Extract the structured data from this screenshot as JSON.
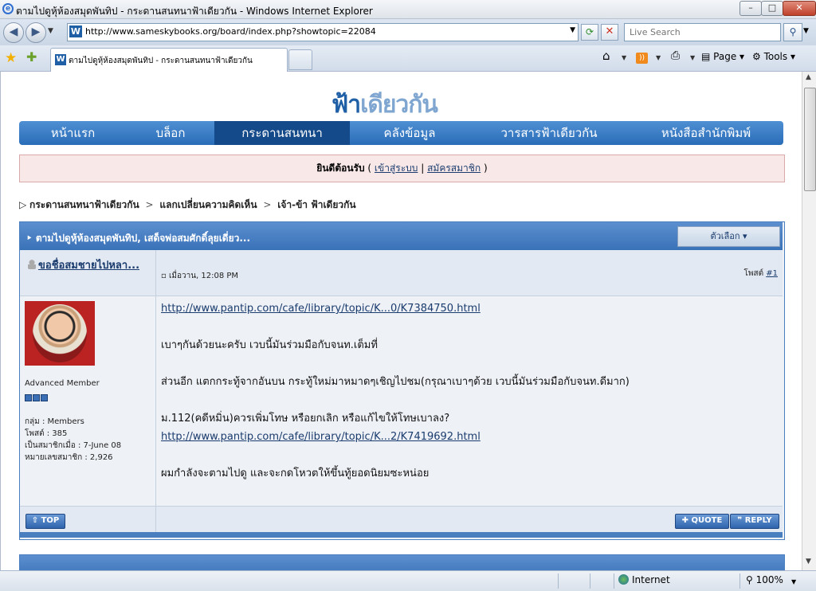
{
  "window": {
    "title": "ตามไปดูหุ้ห้องสมุดพันทิป - กระดานสนทนาฟ้าเดียวกัน - Windows Internet Explorer",
    "minimize_glyph": "–",
    "maximize_glyph": "□",
    "close_glyph": "✕"
  },
  "addressbar": {
    "url": "http://www.sameskybooks.org/board/index.php?showtopic=22084",
    "search_placeholder": "Live Search"
  },
  "tabs": {
    "active_label": "ตามไปดูหุ้ห้องสมุดพันทิป - กระดานสนทนาฟ้าเดียวกัน"
  },
  "commandbar": {
    "page_label": "Page",
    "tools_label": "Tools"
  },
  "statusbar": {
    "zone": "Internet",
    "zoom": "100%"
  },
  "site": {
    "logo_main": "ฟ้า",
    "logo_rest": "เดียวกัน",
    "nav": [
      {
        "label": "หน้าแรก"
      },
      {
        "label": "บล็อก"
      },
      {
        "label": "กระดานสนทนา"
      },
      {
        "label": "คลังข้อมูล"
      },
      {
        "label": "วารสารฟ้าเดียวกัน"
      },
      {
        "label": "หนังสือสำนักพิมพ์"
      }
    ],
    "welcome": {
      "greeting": "ยินดีต้อนรับ",
      "login": "เข้าสู่ระบบ",
      "register": "สมัครสมาชิก"
    },
    "breadcrumb": [
      "กระดานสนทนาฟ้าเดียวกัน",
      "แลกเปลี่ยนความคิดเห็น",
      "เจ้า-ข้า ฟ้าเดียวกัน"
    ]
  },
  "thread": {
    "title": "ตามไปดูหุ้ห้องสมุดพันทิป, เสด็จพ่อสมศักดิ์ลุยเดี่ยว...",
    "options_label": "ตัวเลือก",
    "post": {
      "username": "ขอชื่อสมชายไปหลา...",
      "date": "เมื่อวาน, 12:08 PM",
      "post_label": "โพสต์",
      "post_number": "#1",
      "rank": "Advanced Member",
      "group": "กลุ่ม : Members",
      "posts": "โพสต์ : 385",
      "joined": "เป็นสมาชิกเมื่อ : 7-June 08",
      "member_no": "หมายเลขสมาชิก : 2,926",
      "body": {
        "link1": "http://www.pantip.com/cafe/library/topic/K...0/K7384750.html",
        "line1": "เบาๆกันด้วยนะครับ เวบนี้มันร่วมมือกับจนท.เต็มที่",
        "line2": "ส่วนอีก แตกกระทู้จากอันบน กระทู้ใหม่มาหมาดๆเชิญไปชม(กรุณาเบาๆด้วย เวบนี้มันร่วมมือกับจนท.ดีมาก)",
        "line3": "ม.112(คดีหมิ่น)ควรเพิ่มโทษ หรือยกเลิก หรือแก้ไขให้โทษเบาลง?",
        "link2": "http://www.pantip.com/cafe/library/topic/K...2/K7419692.html",
        "line4": "ผมกำลังจะตามไปดู และจะกดโหวตให้ขึ้นทู้ยอดนิยมซะหน่อย"
      },
      "top_label": "TOP",
      "quote_label": "QUOTE",
      "reply_label": "REPLY"
    }
  }
}
